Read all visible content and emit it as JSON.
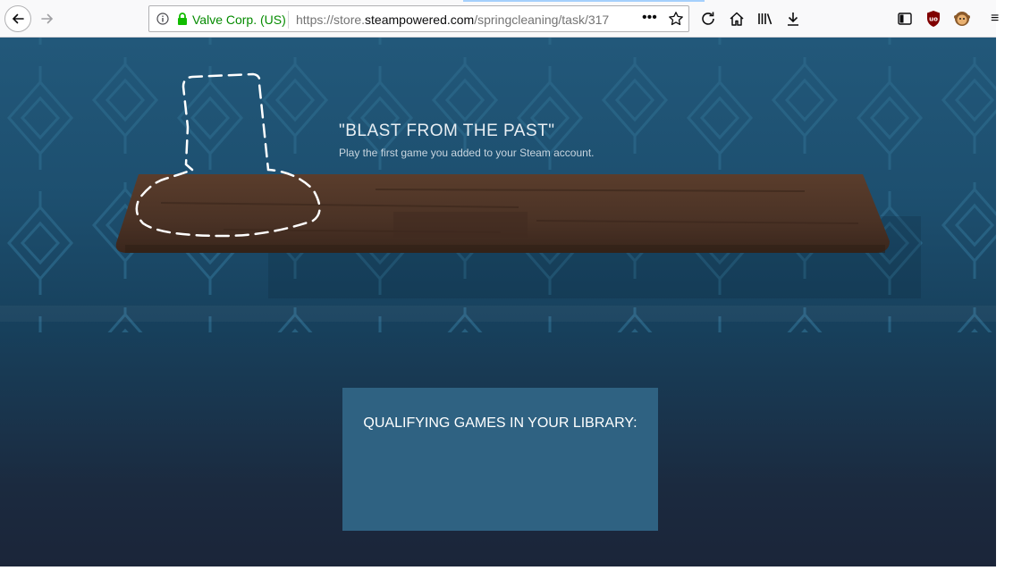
{
  "browser": {
    "identity": "Valve Corp. (US)",
    "url_prefix": "https://store.",
    "url_host": "steampowered.com",
    "url_path": "/springcleaning/task/317",
    "more_label": "•••"
  },
  "task": {
    "title": "\"BLAST FROM THE PAST\"",
    "description": "Play the first game you added to your Steam account."
  },
  "qualifying": {
    "title": "QUALIFYING GAMES IN YOUR LIBRARY:"
  },
  "colors": {
    "identity": "#058b00",
    "shelf": "#4a3225",
    "panel": "#2f6282"
  }
}
